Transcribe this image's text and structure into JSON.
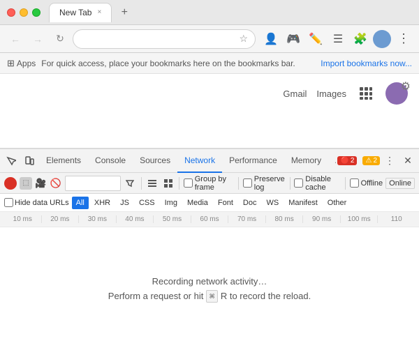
{
  "titlebar": {
    "tab_title": "New Tab",
    "close_label": "×"
  },
  "navbar": {
    "address": "",
    "address_placeholder": ""
  },
  "bookmarks": {
    "apps_label": "Apps",
    "message": "For quick access, place your bookmarks here on the bookmarks bar.",
    "import_link": "Import bookmarks now..."
  },
  "google_bar": {
    "gmail_label": "Gmail",
    "images_label": "Images"
  },
  "devtools": {
    "tabs": [
      {
        "id": "elements",
        "label": "Elements"
      },
      {
        "id": "console",
        "label": "Console"
      },
      {
        "id": "sources",
        "label": "Sources"
      },
      {
        "id": "network",
        "label": "Network"
      },
      {
        "id": "performance",
        "label": "Performance"
      },
      {
        "id": "memory",
        "label": "Memory"
      },
      {
        "id": "application",
        "label": "Application"
      }
    ],
    "active_tab": "network",
    "badges": {
      "error_count": "2",
      "warning_count": "2"
    },
    "toolbar": {
      "record_stop": "⬜",
      "clear": "🚫",
      "filter_placeholder": "",
      "view_list": "☰",
      "view_frame": "⊞",
      "group_by_frame_label": "Group by frame",
      "preserve_log_label": "Preserve log",
      "disable_cache_label": "Disable cache",
      "offline_label": "Offline",
      "online_label": "Online"
    },
    "filter_bar": {
      "hide_urls_label": "Hide data URLs",
      "all_label": "All",
      "types": [
        "XHR",
        "JS",
        "CSS",
        "Img",
        "Media",
        "Font",
        "Doc",
        "WS",
        "Manifest",
        "Other"
      ]
    },
    "timeline": {
      "marks": [
        "10 ms",
        "20 ms",
        "30 ms",
        "40 ms",
        "50 ms",
        "60 ms",
        "70 ms",
        "80 ms",
        "90 ms",
        "100 ms",
        "110"
      ]
    },
    "empty_state": {
      "line1": "Recording network activity…",
      "line2": "Perform a request or hit",
      "shortcut": "⌘",
      "shortcut2": "R",
      "line3": "to record the reload."
    }
  }
}
